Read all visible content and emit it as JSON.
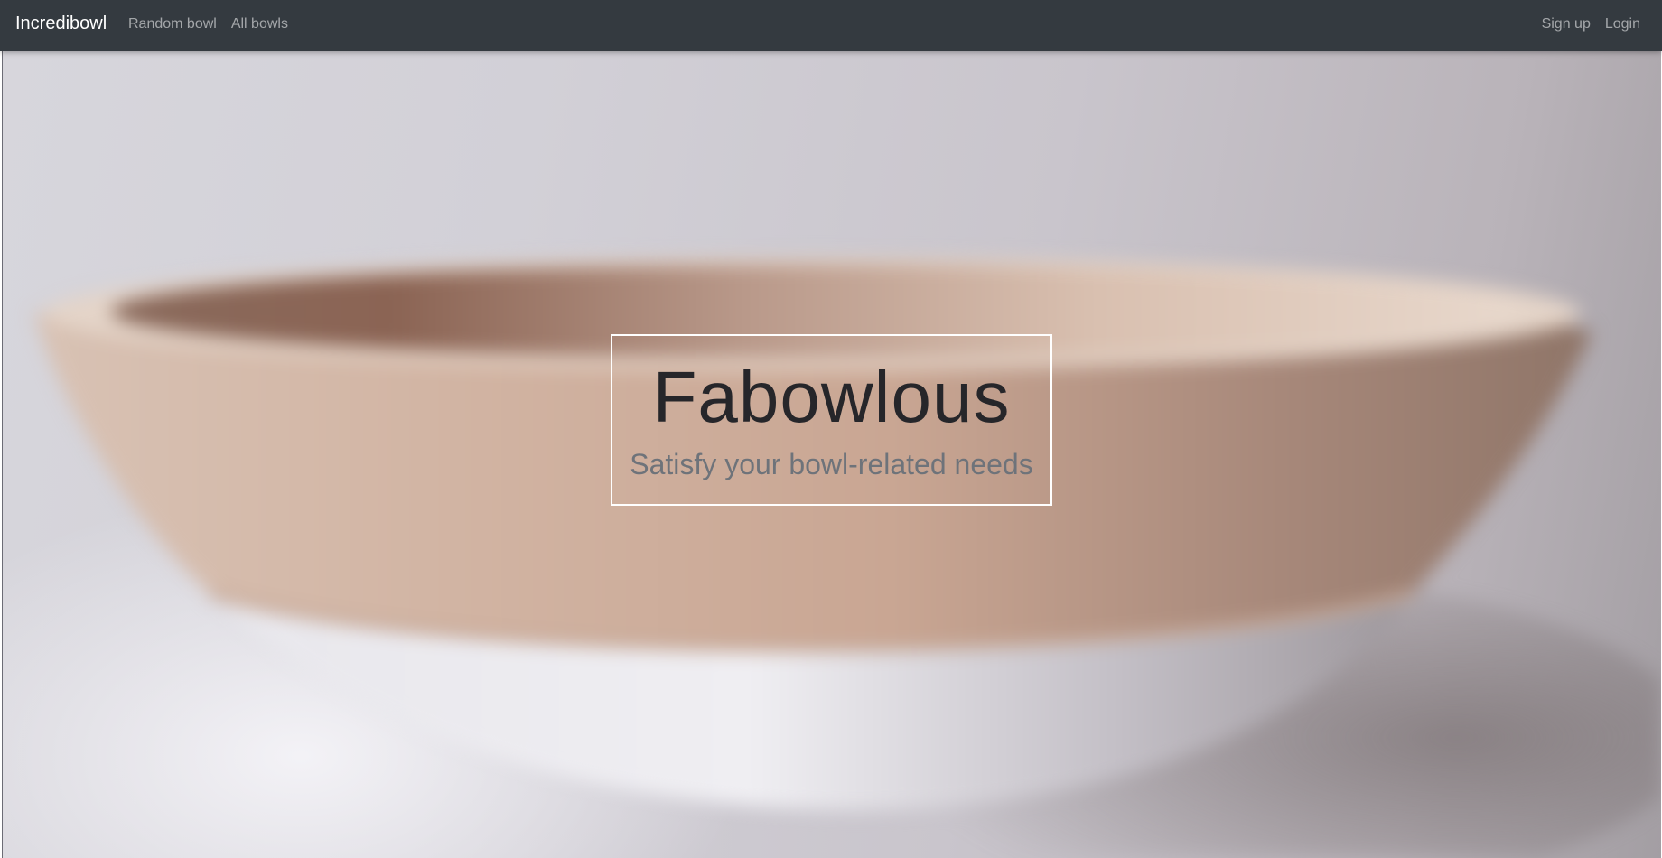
{
  "navbar": {
    "brand": "Incredibowl",
    "left_links": [
      {
        "label": "Random bowl"
      },
      {
        "label": "All bowls"
      }
    ],
    "right_links": [
      {
        "label": "Sign up"
      },
      {
        "label": "Login"
      }
    ],
    "background_color": "#343a40"
  },
  "hero": {
    "image": "blurred-wooden-bowl-photo",
    "title": "Fabowlous",
    "subtitle": "Satisfy your bowl-related needs"
  }
}
